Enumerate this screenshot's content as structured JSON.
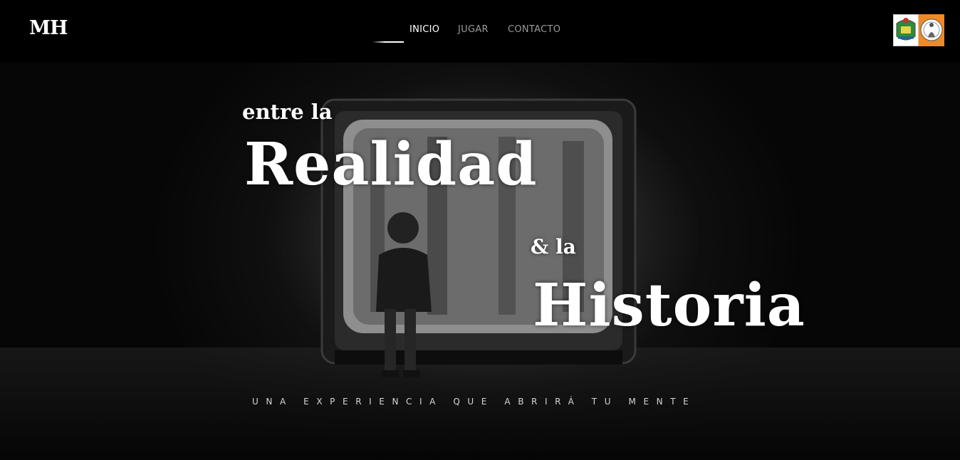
{
  "header": {
    "brand": "MH",
    "nav": [
      {
        "label": "INICIO",
        "active": true
      },
      {
        "label": "JUGAR",
        "active": false
      },
      {
        "label": "CONTACTO",
        "active": false
      }
    ],
    "logos": [
      "coat-of-arms-icon",
      "saint-seal-icon"
    ]
  },
  "hero": {
    "line1": "entre la",
    "line2": "Realidad",
    "line3": "& la",
    "line4": "Historia",
    "tagline": "UNA EXPERIENCIA QUE ABRIRÁ TU MENTE",
    "image": "child-facing-glowing-television"
  },
  "colors": {
    "background": "#000000",
    "text": "#ffffff",
    "nav_inactive": "#9a9a9a",
    "logo_accent": "#f08a24"
  }
}
